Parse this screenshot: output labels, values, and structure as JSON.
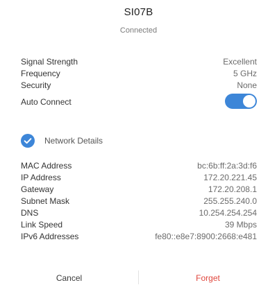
{
  "header": {
    "network_name": "SI07B",
    "status": "Connected"
  },
  "info": [
    {
      "label": "Signal Strength",
      "value": "Excellent"
    },
    {
      "label": "Frequency",
      "value": "5 GHz"
    },
    {
      "label": "Security",
      "value": "None"
    }
  ],
  "auto_connect": {
    "label": "Auto Connect",
    "enabled": true
  },
  "network_details": {
    "label": "Network Details",
    "checked": true,
    "rows": [
      {
        "label": "MAC Address",
        "value": "bc:6b:ff:2a:3d:f6"
      },
      {
        "label": "IP Address",
        "value": "172.20.221.45"
      },
      {
        "label": "Gateway",
        "value": "172.20.208.1"
      },
      {
        "label": "Subnet Mask",
        "value": "255.255.240.0"
      },
      {
        "label": "DNS",
        "value": "10.254.254.254"
      },
      {
        "label": "Link Speed",
        "value": "39 Mbps"
      },
      {
        "label": "IPv6 Addresses",
        "value": "fe80::e8e7:8900:2668:e481"
      }
    ]
  },
  "footer": {
    "cancel_label": "Cancel",
    "forget_label": "Forget"
  },
  "colors": {
    "accent": "#3d86d8",
    "danger": "#e0463d"
  },
  "icons": {
    "details_check": "check-circle-icon"
  }
}
